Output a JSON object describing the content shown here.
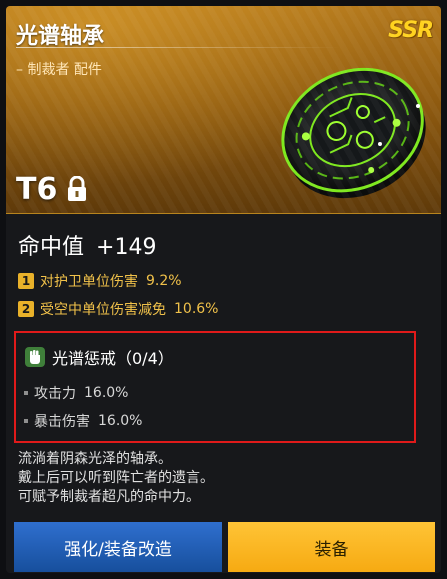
{
  "item": {
    "name": "光谱轴承",
    "subtitle": "– 制裁者  配件",
    "rarity": "SSR",
    "tier": "T6",
    "lock_icon": "lock-icon"
  },
  "stats": {
    "main": {
      "label": "命中值",
      "value": "+149"
    },
    "subs": [
      {
        "index": "1",
        "label": "对护卫单位伤害",
        "value": "9.2%"
      },
      {
        "index": "2",
        "label": "受空中单位伤害减免",
        "value": "10.6%"
      }
    ]
  },
  "set_bonus": {
    "icon": "fist-icon",
    "title": "光谱惩戒（0/4）",
    "lines": [
      {
        "label": "攻击力",
        "value": "16.0%"
      },
      {
        "label": "暴击伤害",
        "value": "16.0%"
      }
    ],
    "highlight_color": "#e01a1a"
  },
  "description": {
    "lines": [
      "流淌着阴森光泽的轴承。",
      "戴上后可以听到阵亡者的遗言。",
      "可赋予制裁者超凡的命中力。"
    ]
  },
  "buttons": {
    "upgrade_label": "强化/装备改造",
    "equip_label": "装备"
  },
  "colors": {
    "header_gold": "#a56c16",
    "rarity_yellow": "#ffd21e",
    "button_blue": "#2360b6",
    "button_yellow": "#ffbb2a",
    "accent_green": "#7ee81e"
  }
}
